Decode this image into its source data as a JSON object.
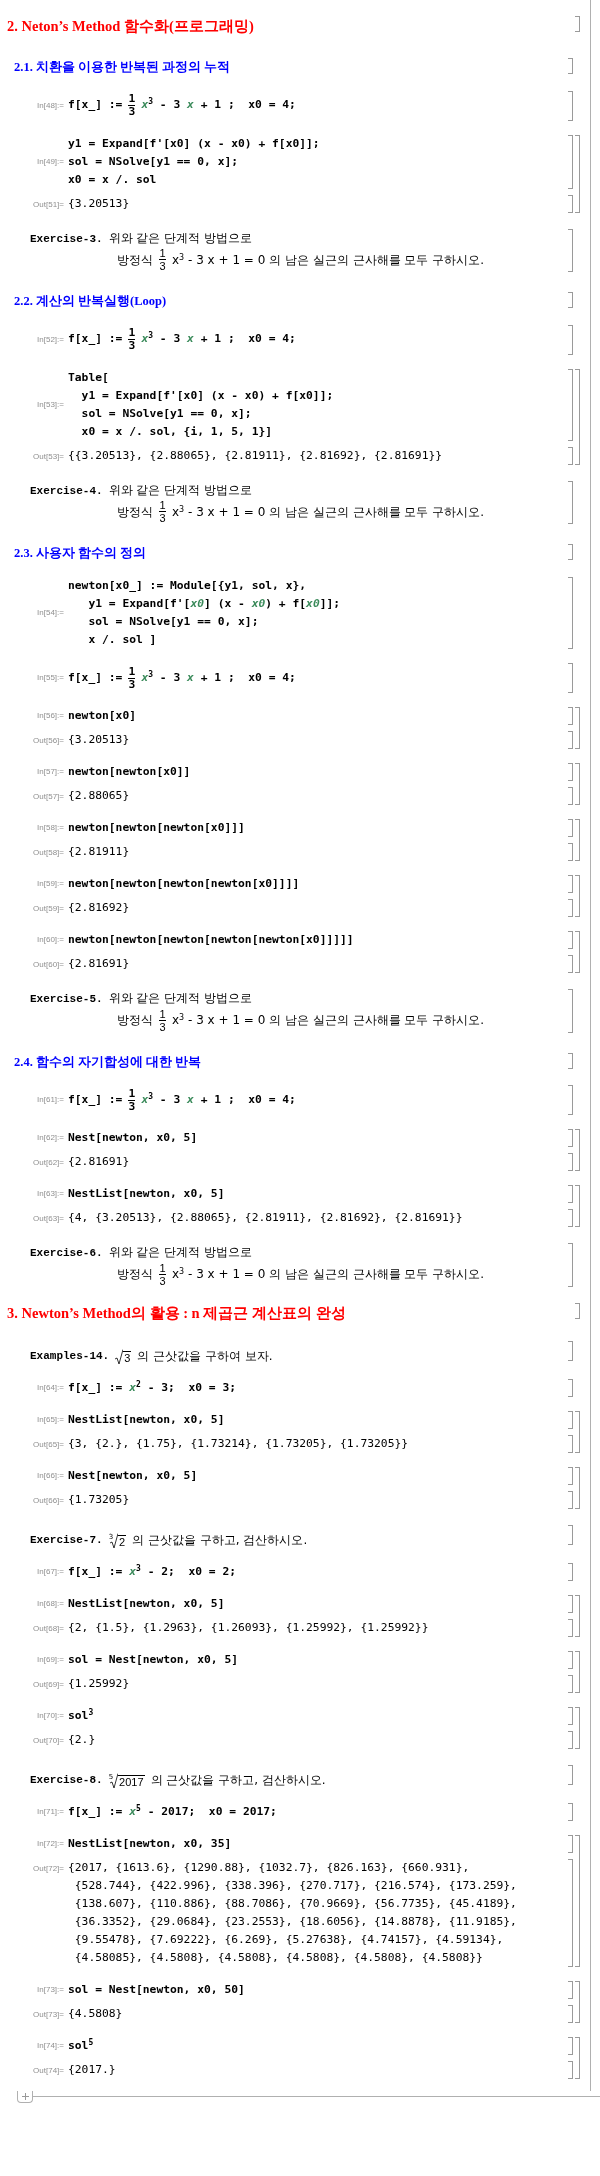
{
  "cells": [
    {
      "kind": "title",
      "text": "2. Neton’s Method 함수화(프로그래밍)"
    },
    {
      "kind": "subtitle",
      "text": "2.1. 치환을 이용한 반복된 과정의 누적"
    },
    {
      "kind": "io",
      "input": {
        "label": "In[48]:=",
        "kind": "fraction",
        "before": "f[x_] :=",
        "numerator": "1",
        "denominator": "3",
        "after": "*x*$^{3}$ - 3 *x* + 1 ;  x0 = 4;"
      }
    },
    {
      "kind": "io",
      "input": {
        "label": "In[49]:=",
        "kind": "code",
        "lines": [
          "y1 = Expand[f'[x0] (x - x0) + f[x0]];",
          "sol = NSolve[y1 == 0, x];",
          "x0 = x /. sol"
        ]
      },
      "output": {
        "label": "Out[51]=",
        "lines": [
          "{3.20513}"
        ]
      }
    },
    {
      "kind": "exercise",
      "label": "Exercise-3.",
      "text": "위와 같은 단계적 방법으로",
      "lead": "방정식",
      "numerator": "1",
      "denominator": "3",
      "rest": "x$^{3}$ - 3 x + 1  = 0 의 남은 실근의 근사해를 모두 구하시오."
    },
    {
      "kind": "subtitle",
      "text": "2.2. 계산의 반복실행(Loop)"
    },
    {
      "kind": "io",
      "input": {
        "label": "In[52]:=",
        "kind": "fraction",
        "before": "f[x_] :=",
        "numerator": "1",
        "denominator": "3",
        "after": "*x*$^{3}$ - 3 *x* + 1 ;  x0 = 4;"
      }
    },
    {
      "kind": "io",
      "input": {
        "label": "In[53]:=",
        "kind": "code",
        "lines": [
          "Table[",
          "  y1 = Expand[f'[x0] (x - x0) + f[x0]];",
          "  sol = NSolve[y1 == 0, x];",
          "  x0 = x /. sol, {i, 1, 5, 1}]"
        ]
      },
      "output": {
        "label": "Out[53]=",
        "lines": [
          "{{3.20513}, {2.88065}, {2.81911}, {2.81692}, {2.81691}}"
        ]
      }
    },
    {
      "kind": "exercise",
      "label": "Exercise-4.",
      "text": "위와 같은 단계적 방법으로",
      "lead": "방정식",
      "numerator": "1",
      "denominator": "3",
      "rest": "x$^{3}$ - 3 x + 1  = 0 의 남은 실근의 근사해를 모두 구하시오."
    },
    {
      "kind": "subtitle",
      "text": "2.3. 사용자 함수의 정의"
    },
    {
      "kind": "io",
      "input": {
        "label": "In[54]:=",
        "kind": "code",
        "lines": [
          "newton[x0_] := Module[{y1, sol, x},",
          "   y1 = Expand[f'[*x0*] (x - *x0*) + f[*x0*]];",
          "   sol = NSolve[y1 == 0, x];",
          "   x /. sol ]"
        ]
      }
    },
    {
      "kind": "io",
      "input": {
        "label": "In[55]:=",
        "kind": "fraction",
        "before": "f[x_] :=",
        "numerator": "1",
        "denominator": "3",
        "after": "*x*$^{3}$ - 3 *x* + 1 ;  x0 = 4;"
      }
    },
    {
      "kind": "io",
      "input": {
        "label": "In[56]:=",
        "kind": "code",
        "lines": [
          "newton[x0]"
        ]
      },
      "output": {
        "label": "Out[56]=",
        "lines": [
          "{3.20513}"
        ]
      }
    },
    {
      "kind": "io",
      "input": {
        "label": "In[57]:=",
        "kind": "code",
        "lines": [
          "newton[newton[x0]]"
        ]
      },
      "output": {
        "label": "Out[57]=",
        "lines": [
          "{2.88065}"
        ]
      }
    },
    {
      "kind": "io",
      "input": {
        "label": "In[58]:=",
        "kind": "code",
        "lines": [
          "newton[newton[newton[x0]]]"
        ]
      },
      "output": {
        "label": "Out[58]=",
        "lines": [
          "{2.81911}"
        ]
      }
    },
    {
      "kind": "io",
      "input": {
        "label": "In[59]:=",
        "kind": "code",
        "lines": [
          "newton[newton[newton[newton[x0]]]]"
        ]
      },
      "output": {
        "label": "Out[59]=",
        "lines": [
          "{2.81692}"
        ]
      }
    },
    {
      "kind": "io",
      "input": {
        "label": "In[60]:=",
        "kind": "code",
        "lines": [
          "newton[newton[newton[newton[newton[x0]]]]]"
        ]
      },
      "output": {
        "label": "Out[60]=",
        "lines": [
          "{2.81691}"
        ]
      }
    },
    {
      "kind": "exercise",
      "label": "Exercise-5.",
      "text": "위와 같은 단계적 방법으로",
      "lead": "방정식",
      "numerator": "1",
      "denominator": "3",
      "rest": "x$^{3}$ - 3 x + 1  = 0 의 남은 실근의 근사해를 모두 구하시오."
    },
    {
      "kind": "subtitle",
      "text": "2.4. 함수의 자기합성에 대한 반복"
    },
    {
      "kind": "io",
      "input": {
        "label": "In[61]:=",
        "kind": "fraction",
        "before": "f[x_] :=",
        "numerator": "1",
        "denominator": "3",
        "after": "*x*$^{3}$ - 3 *x* + 1 ;  x0 = 4;"
      }
    },
    {
      "kind": "io",
      "input": {
        "label": "In[62]:=",
        "kind": "code",
        "lines": [
          "Nest[newton, x0, 5]"
        ]
      },
      "output": {
        "label": "Out[62]=",
        "lines": [
          "{2.81691}"
        ]
      }
    },
    {
      "kind": "io",
      "input": {
        "label": "In[63]:=",
        "kind": "code",
        "lines": [
          "NestList[newton, x0, 5]"
        ]
      },
      "output": {
        "label": "Out[63]=",
        "lines": [
          "{4, {3.20513}, {2.88065}, {2.81911}, {2.81692}, {2.81691}}"
        ]
      }
    },
    {
      "kind": "exercise",
      "label": "Exercise-6.",
      "text": "위와 같은 단계적 방법으로",
      "lead": "방정식",
      "numerator": "1",
      "denominator": "3",
      "rest": "x$^{3}$ - 3 x + 1  = 0 의 남은 실근의 근사해를 모두 구하시오."
    },
    {
      "kind": "title",
      "text": "3. Newton’s Method의 활용 : n 제곱근 계산표의 완성"
    },
    {
      "kind": "root",
      "label": "Examples-14.",
      "radicand": "3",
      "text": "의 근삿값을 구하여 보자."
    },
    {
      "kind": "io",
      "input": {
        "label": "In[64]:=",
        "kind": "code",
        "lines": [
          "f[x_] := *x*$^{2}$ - 3;  x0 = 3;"
        ]
      }
    },
    {
      "kind": "io",
      "input": {
        "label": "In[65]:=",
        "kind": "code",
        "lines": [
          "NestList[newton, x0, 5]"
        ]
      },
      "output": {
        "label": "Out[65]=",
        "lines": [
          "{3, {2.}, {1.75}, {1.73214}, {1.73205}, {1.73205}}"
        ]
      }
    },
    {
      "kind": "io",
      "input": {
        "label": "In[66]:=",
        "kind": "code",
        "lines": [
          "Nest[newton, x0, 5]"
        ]
      },
      "output": {
        "label": "Out[66]=",
        "lines": [
          "{1.73205}"
        ]
      }
    },
    {
      "kind": "root",
      "label": "Exercise-7.",
      "index": "3",
      "radicand": "2",
      "text": "의 근삿값을 구하고, 검산하시오."
    },
    {
      "kind": "io",
      "input": {
        "label": "In[67]:=",
        "kind": "code",
        "lines": [
          "f[x_] := *x*$^{3}$ - 2;  x0 = 2;"
        ]
      }
    },
    {
      "kind": "io",
      "input": {
        "label": "In[68]:=",
        "kind": "code",
        "lines": [
          "NestList[newton, x0, 5]"
        ]
      },
      "output": {
        "label": "Out[68]=",
        "lines": [
          "{2, {1.5}, {1.2963}, {1.26093}, {1.25992}, {1.25992}}"
        ]
      }
    },
    {
      "kind": "io",
      "input": {
        "label": "In[69]:=",
        "kind": "code",
        "lines": [
          "sol = Nest[newton, x0, 5]"
        ]
      },
      "output": {
        "label": "Out[69]=",
        "lines": [
          "{1.25992}"
        ]
      }
    },
    {
      "kind": "io",
      "input": {
        "label": "In[70]:=",
        "kind": "code",
        "lines": [
          "sol$^{3}$"
        ]
      },
      "output": {
        "label": "Out[70]=",
        "lines": [
          "{2.}"
        ]
      }
    },
    {
      "kind": "root",
      "label": "Exercise-8.",
      "index": "5",
      "radicand": "2017",
      "text": "의 근삿값을 구하고, 검산하시오."
    },
    {
      "kind": "io",
      "input": {
        "label": "In[71]:=",
        "kind": "code",
        "lines": [
          "f[x_] := *x*$^{5}$ - 2017;  x0 = 2017;"
        ]
      }
    },
    {
      "kind": "io",
      "input": {
        "label": "In[72]:=",
        "kind": "code",
        "lines": [
          "NestList[newton, x0, 35]"
        ]
      },
      "output": {
        "label": "Out[72]=",
        "lines": [
          "{2017, {1613.6}, {1290.88}, {1032.7}, {826.163}, {660.931},",
          " {528.744}, {422.996}, {338.396}, {270.717}, {216.574}, {173.259},",
          " {138.607}, {110.886}, {88.7086}, {70.9669}, {56.7735}, {45.4189},",
          " {36.3352}, {29.0684}, {23.2553}, {18.6056}, {14.8878}, {11.9185},",
          " {9.55478}, {7.69222}, {6.269}, {5.27638}, {4.74157}, {4.59134},",
          " {4.58085}, {4.5808}, {4.5808}, {4.5808}, {4.5808}, {4.5808}}"
        ]
      }
    },
    {
      "kind": "io",
      "input": {
        "label": "In[73]:=",
        "kind": "code",
        "lines": [
          "sol = Nest[newton, x0, 50]"
        ]
      },
      "output": {
        "label": "Out[73]=",
        "lines": [
          "{4.5808}"
        ]
      }
    },
    {
      "kind": "io",
      "input": {
        "label": "In[74]:=",
        "kind": "code",
        "lines": [
          "sol$^{5}$"
        ]
      },
      "output": {
        "label": "Out[74]=",
        "lines": [
          "{2017.}"
        ]
      }
    }
  ]
}
